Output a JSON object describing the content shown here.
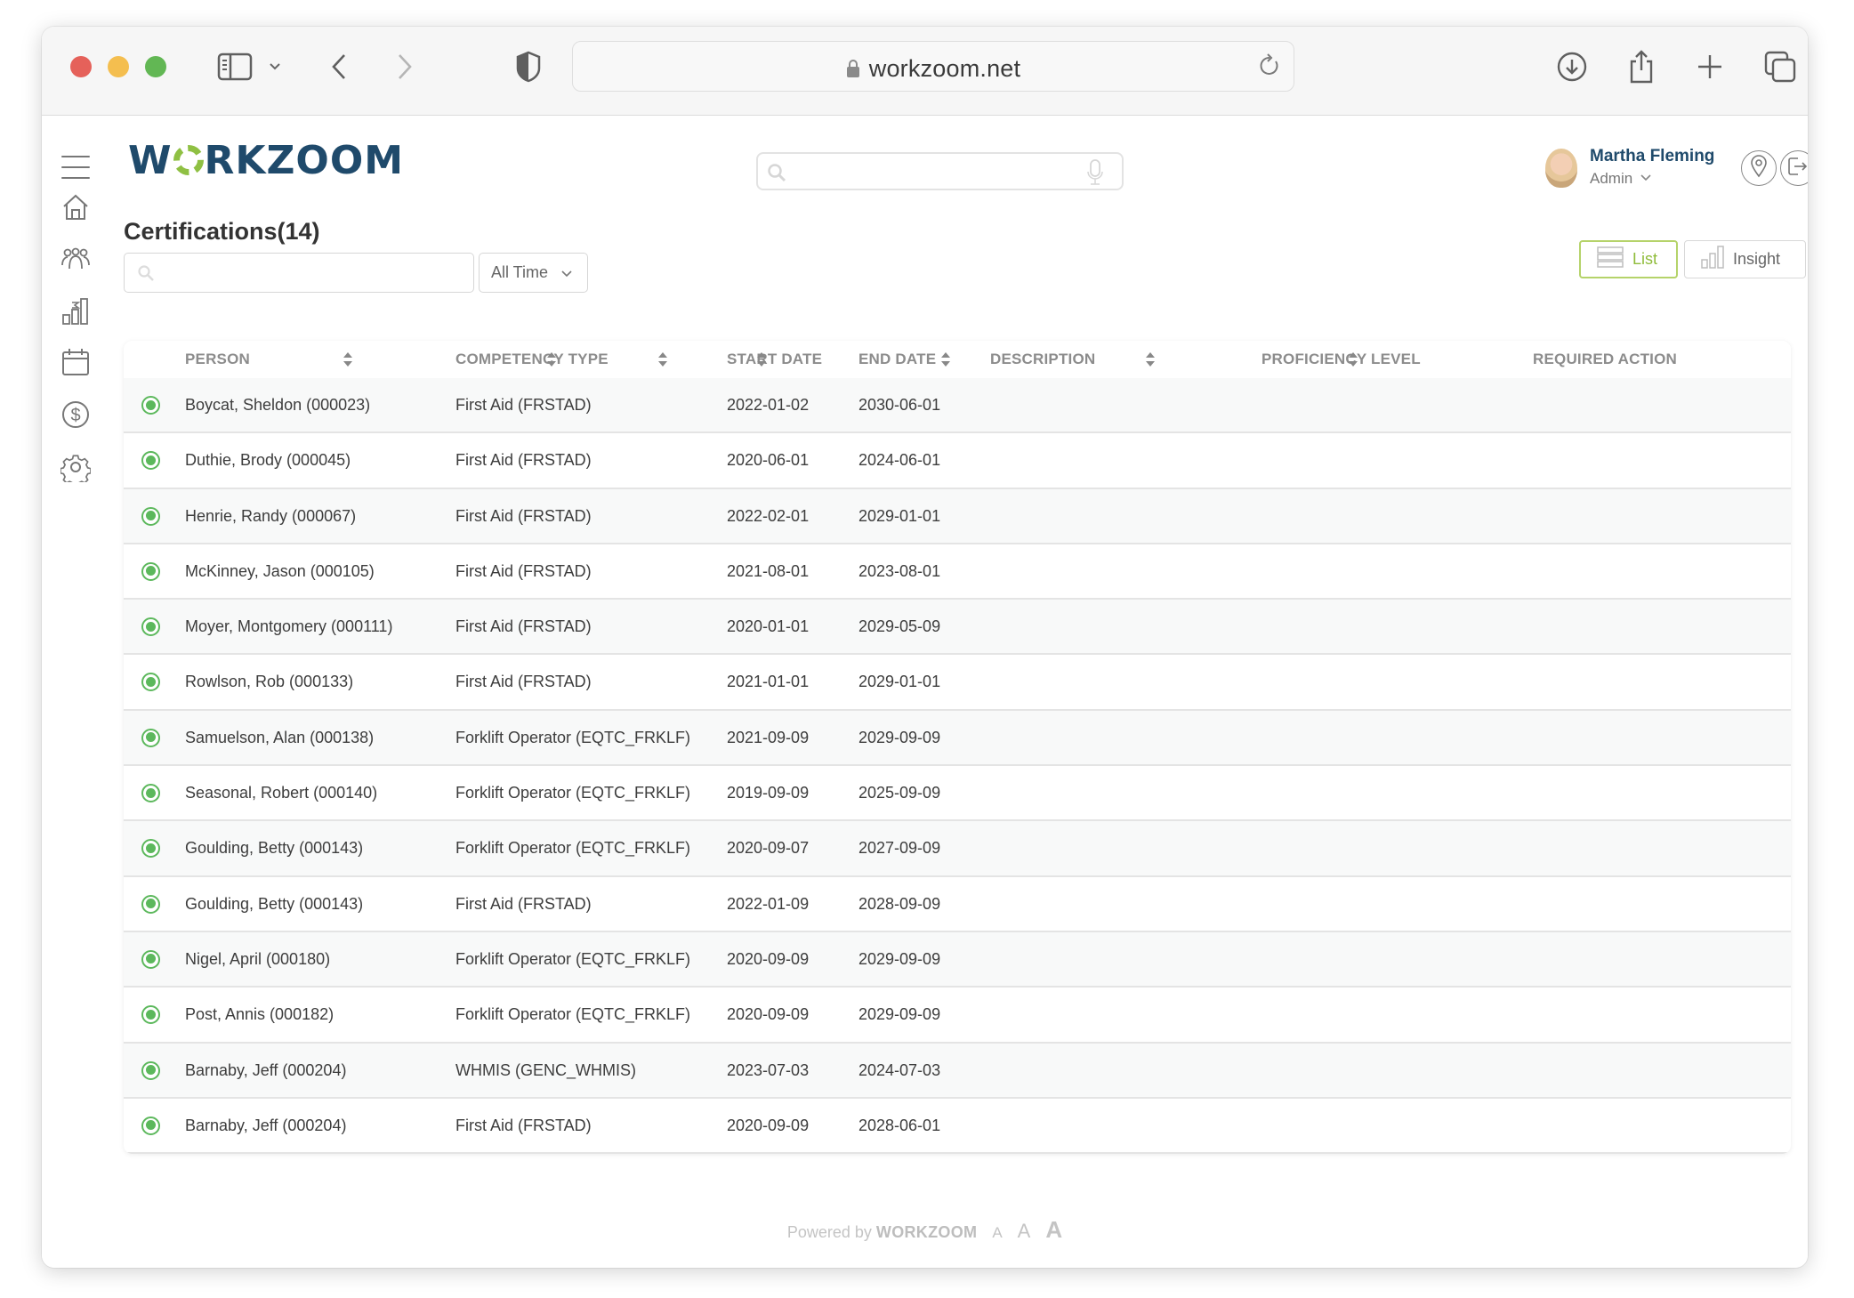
{
  "browser": {
    "url": "workzoom.net",
    "icons": [
      "sidebar-toggle-icon",
      "chevron-down-icon",
      "back-icon",
      "forward-icon",
      "privacy-shield-icon",
      "lock-icon",
      "reload-icon",
      "download-icon",
      "share-icon",
      "new-tab-icon",
      "tab-overview-icon"
    ]
  },
  "app": {
    "logo_text_before": "W",
    "logo_text_after": "RKZOOM",
    "search_placeholder": "",
    "user": {
      "name": "Martha Fleming",
      "role": "Admin"
    },
    "sidebar": [
      "home-icon",
      "people-icon",
      "reports-icon",
      "calendar-icon",
      "payroll-icon",
      "settings-icon"
    ]
  },
  "page": {
    "title": "Certifications(14)",
    "search_value": "",
    "time_filter": "All Time",
    "views": {
      "list": "List",
      "insight": "Insight",
      "active": "List"
    }
  },
  "table": {
    "columns": [
      "PERSON",
      "COMPETENCY TYPE",
      "START DATE",
      "END DATE",
      "DESCRIPTION",
      "PROFICIENCY LEVEL",
      "REQUIRED ACTION"
    ],
    "rows": [
      {
        "status": "active",
        "person": "Boycat, Sheldon (000023)",
        "competency": "First Aid (FRSTAD)",
        "start": "2022-01-02",
        "end": "2030-06-01",
        "description": "",
        "proficiency": "",
        "required_action": ""
      },
      {
        "status": "active",
        "person": "Duthie, Brody (000045)",
        "competency": "First Aid (FRSTAD)",
        "start": "2020-06-01",
        "end": "2024-06-01",
        "description": "",
        "proficiency": "",
        "required_action": ""
      },
      {
        "status": "active",
        "person": "Henrie, Randy (000067)",
        "competency": "First Aid (FRSTAD)",
        "start": "2022-02-01",
        "end": "2029-01-01",
        "description": "",
        "proficiency": "",
        "required_action": ""
      },
      {
        "status": "active",
        "person": "McKinney, Jason (000105)",
        "competency": "First Aid (FRSTAD)",
        "start": "2021-08-01",
        "end": "2023-08-01",
        "description": "",
        "proficiency": "",
        "required_action": ""
      },
      {
        "status": "active",
        "person": "Moyer, Montgomery (000111)",
        "competency": "First Aid (FRSTAD)",
        "start": "2020-01-01",
        "end": "2029-05-09",
        "description": "",
        "proficiency": "",
        "required_action": ""
      },
      {
        "status": "active",
        "person": "Rowlson, Rob (000133)",
        "competency": "First Aid (FRSTAD)",
        "start": "2021-01-01",
        "end": "2029-01-01",
        "description": "",
        "proficiency": "",
        "required_action": ""
      },
      {
        "status": "active",
        "person": "Samuelson, Alan (000138)",
        "competency": "Forklift Operator (EQTC_FRKLF)",
        "start": "2021-09-09",
        "end": "2029-09-09",
        "description": "",
        "proficiency": "",
        "required_action": ""
      },
      {
        "status": "active",
        "person": "Seasonal, Robert (000140)",
        "competency": "Forklift Operator (EQTC_FRKLF)",
        "start": "2019-09-09",
        "end": "2025-09-09",
        "description": "",
        "proficiency": "",
        "required_action": ""
      },
      {
        "status": "active",
        "person": "Goulding, Betty (000143)",
        "competency": "Forklift Operator (EQTC_FRKLF)",
        "start": "2020-09-07",
        "end": "2027-09-09",
        "description": "",
        "proficiency": "",
        "required_action": ""
      },
      {
        "status": "active",
        "person": "Goulding, Betty (000143)",
        "competency": "First Aid (FRSTAD)",
        "start": "2022-01-09",
        "end": "2028-09-09",
        "description": "",
        "proficiency": "",
        "required_action": ""
      },
      {
        "status": "active",
        "person": "Nigel, April (000180)",
        "competency": "Forklift Operator (EQTC_FRKLF)",
        "start": "2020-09-09",
        "end": "2029-09-09",
        "description": "",
        "proficiency": "",
        "required_action": ""
      },
      {
        "status": "active",
        "person": "Post, Annis (000182)",
        "competency": "Forklift Operator (EQTC_FRKLF)",
        "start": "2020-09-09",
        "end": "2029-09-09",
        "description": "",
        "proficiency": "",
        "required_action": ""
      },
      {
        "status": "active",
        "person": "Barnaby, Jeff (000204)",
        "competency": "WHMIS (GENC_WHMIS)",
        "start": "2023-07-03",
        "end": "2024-07-03",
        "description": "",
        "proficiency": "",
        "required_action": ""
      },
      {
        "status": "active",
        "person": "Barnaby, Jeff (000204)",
        "competency": "First Aid (FRSTAD)",
        "start": "2020-09-09",
        "end": "2028-06-01",
        "description": "",
        "proficiency": "",
        "required_action": ""
      }
    ]
  },
  "footer": {
    "powered_by": "Powered by",
    "brand": "WORKZOOM",
    "font_sizes": [
      "A",
      "A",
      "A"
    ]
  },
  "colors": {
    "brand_navy": "#1f4a6b",
    "brand_green": "#8fc043",
    "status_green": "#5cb85c",
    "active_view_border": "#b5d36a"
  }
}
